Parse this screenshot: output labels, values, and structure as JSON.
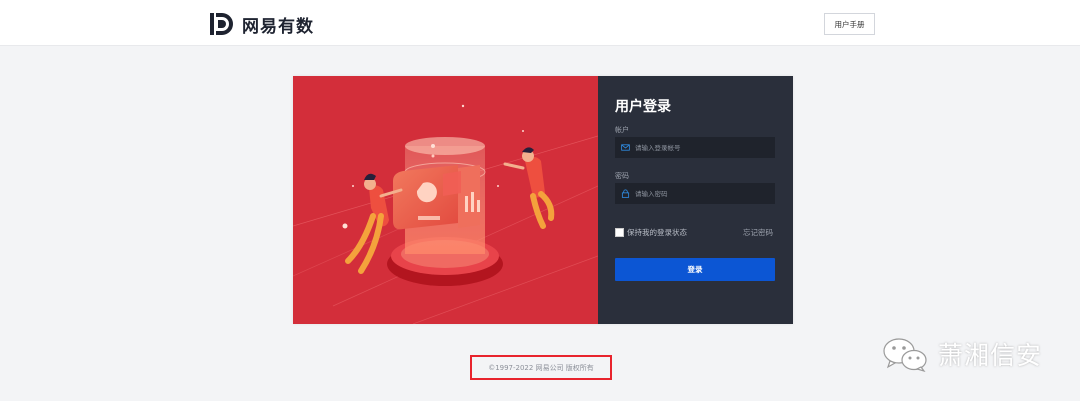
{
  "header": {
    "brand": "网易有数",
    "manual_button": "用户手册"
  },
  "login": {
    "title": "用户登录",
    "account_label": "帐户",
    "account_placeholder": "请输入登录帐号",
    "password_label": "密码",
    "password_placeholder": "请输入密码",
    "remember_label": "保持我的登录状态",
    "remember_checked": false,
    "forgot_link": "忘记密码",
    "submit_label": "登录"
  },
  "footer": {
    "copyright": "©1997-2022 网易公司 版权所有"
  },
  "watermark": {
    "text": "萧湘信安",
    "icon": "wechat-icon"
  },
  "colors": {
    "accent": "#0c56d4",
    "illustration_bg": "#d32e3a",
    "panel_bg": "#2a2f3b",
    "highlight": "#e8232d"
  }
}
